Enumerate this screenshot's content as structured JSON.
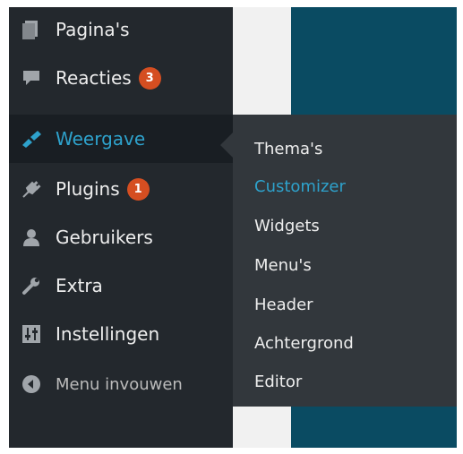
{
  "sidebar": {
    "items": [
      {
        "label": "Pagina's",
        "icon": "pages-icon"
      },
      {
        "label": "Reacties",
        "icon": "comments-icon",
        "badge": "3"
      },
      {
        "label": "Weergave",
        "icon": "appearance-icon",
        "active": true
      },
      {
        "label": "Plugins",
        "icon": "plugins-icon",
        "badge": "1"
      },
      {
        "label": "Gebruikers",
        "icon": "users-icon"
      },
      {
        "label": "Extra",
        "icon": "tools-icon"
      },
      {
        "label": "Instellingen",
        "icon": "settings-icon"
      }
    ],
    "collapse_label": "Menu invouwen"
  },
  "submenu": {
    "items": [
      {
        "label": "Thema's"
      },
      {
        "label": "Customizer",
        "current": true
      },
      {
        "label": "Widgets"
      },
      {
        "label": "Menu's"
      },
      {
        "label": "Header"
      },
      {
        "label": "Achtergrond"
      },
      {
        "label": "Editor"
      }
    ]
  },
  "colors": {
    "sidebar_bg": "#23282d",
    "submenu_bg": "#32373c",
    "accent": "#2ea2cc",
    "badge": "#d54e21",
    "content_teal": "#0a4b62"
  }
}
